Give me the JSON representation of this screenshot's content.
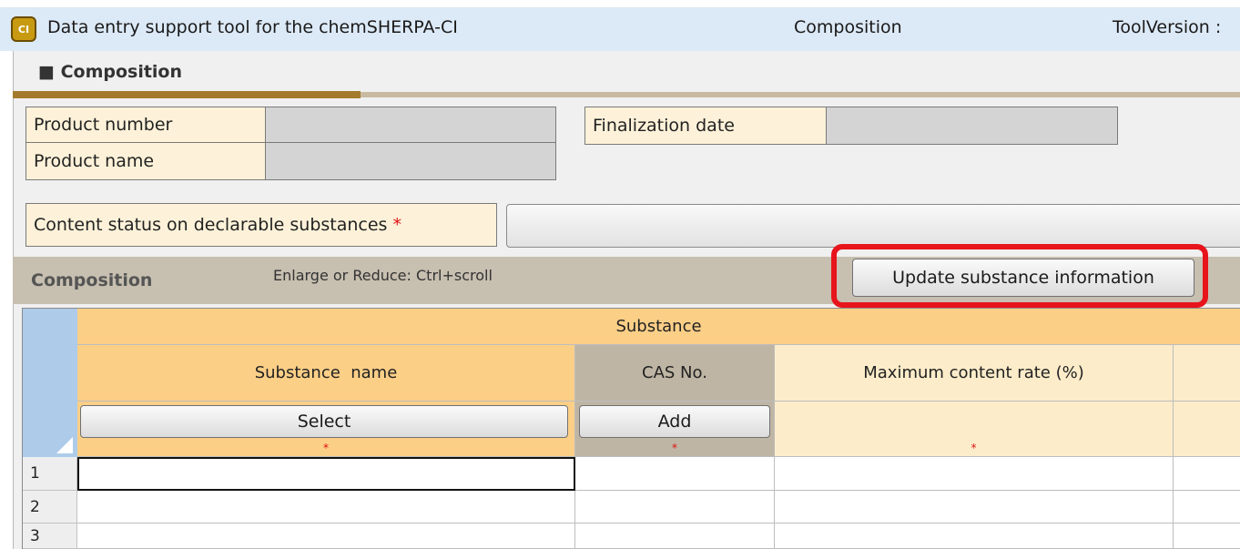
{
  "titlebar": {
    "icon_text": "CI",
    "app_title": "Data entry support tool for the chemSHERPA-CI",
    "screen_name": "Composition",
    "tool_version": "ToolVersion :"
  },
  "section": {
    "title": "■ Composition"
  },
  "product": {
    "number_label": "Product number",
    "number_value": "",
    "name_label": "Product name",
    "name_value": "",
    "finalization_label": "Finalization date",
    "finalization_value": ""
  },
  "content_status": {
    "label": "Content status on declarable substances",
    "required_mark": "*",
    "selected": ""
  },
  "composition_bar": {
    "title": "Composition",
    "zoom_hint": "Enlarge or Reduce: Ctrl+scroll",
    "update_button": "Update substance information"
  },
  "grid": {
    "group_header": "Substance",
    "columns": [
      {
        "label": "Substance  name",
        "button": "Select",
        "required": "*"
      },
      {
        "label": "CAS No.",
        "button": "Add",
        "required": "*"
      },
      {
        "label": "Maximum content rate (%)",
        "button": "",
        "required": "*"
      }
    ],
    "rows": [
      {
        "num": "1",
        "cells": [
          "",
          "",
          ""
        ]
      },
      {
        "num": "2",
        "cells": [
          "",
          "",
          ""
        ]
      },
      {
        "num": "3",
        "cells": [
          "",
          "",
          ""
        ]
      }
    ]
  },
  "colors": {
    "highlight": "#e8141b",
    "header_orange": "#fccf87",
    "header_gray": "#bfb5a4",
    "label_cream": "#fdf2d9",
    "titlebar": "#dce9f7"
  }
}
